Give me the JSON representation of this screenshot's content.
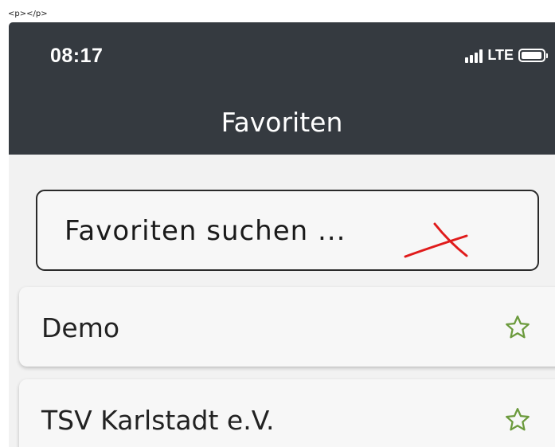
{
  "page_caption": "<p></p>",
  "status_bar": {
    "time": "08:17",
    "network": "LTE",
    "icons": [
      "signal-icon",
      "battery-icon"
    ]
  },
  "header": {
    "title": "Favoriten"
  },
  "search": {
    "placeholder": "Favoriten suchen ..."
  },
  "favorites": [
    {
      "name": "Demo",
      "icon": "star-outline-icon"
    },
    {
      "name": "TSV Karlstadt e.V.",
      "icon": "star-outline-icon"
    }
  ],
  "colors": {
    "header_bg": "#353a40",
    "background": "#f2f2f2",
    "star": "#6b9a3c",
    "annotation": "#e01b1b"
  }
}
